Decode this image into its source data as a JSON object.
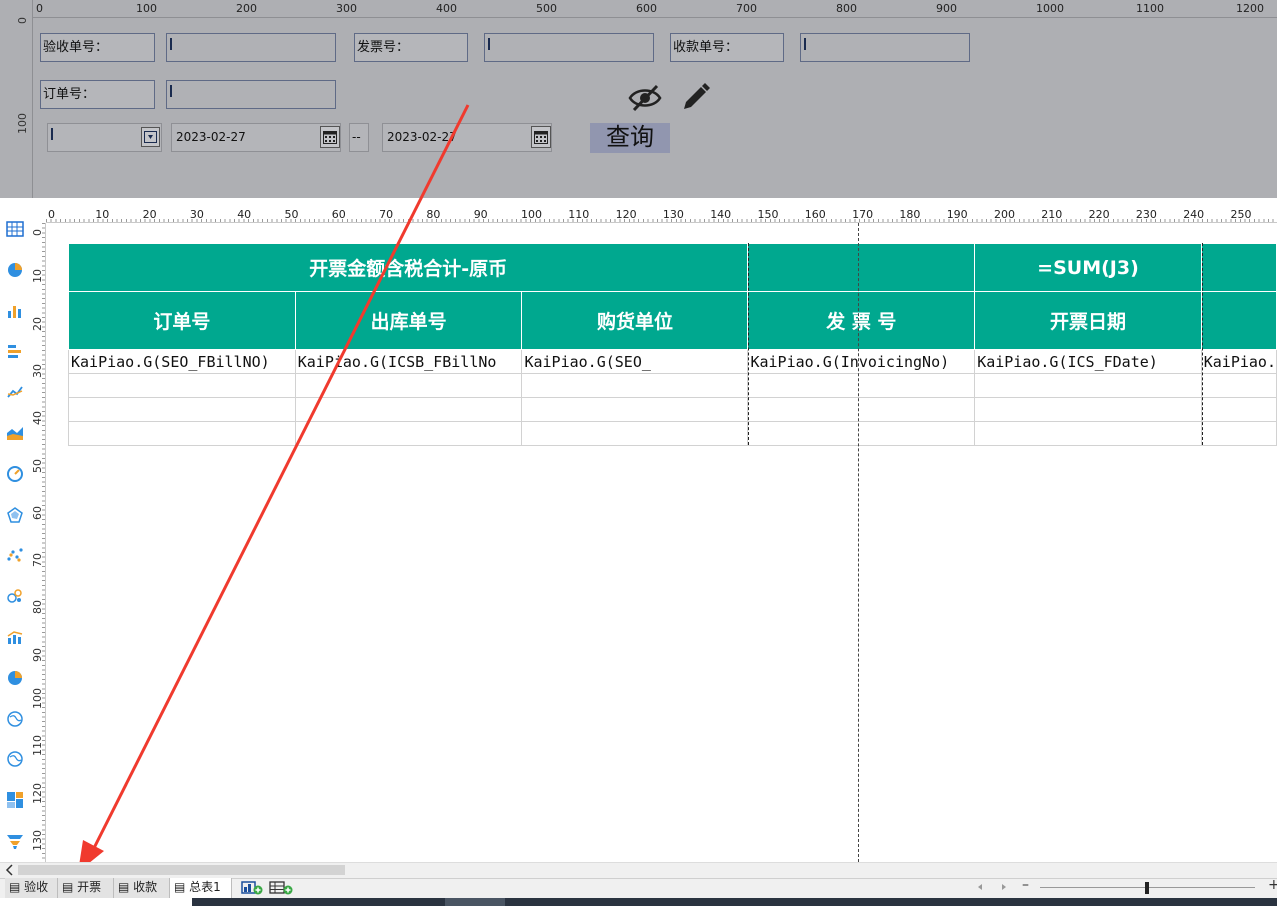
{
  "param_panel": {
    "ruler_top": [
      "0",
      "100",
      "200",
      "300",
      "400",
      "500",
      "600",
      "700",
      "800",
      "900",
      "1000",
      "1100",
      "1200"
    ],
    "ruler_left": [
      "0",
      "100"
    ],
    "fields": {
      "acceptance_no_label": "验收单号：",
      "invoice_no_label": "发票号：",
      "receipt_no_label": "收款单号：",
      "order_no_label": "订单号："
    },
    "start_date": "2023-02-27",
    "date_separator": "--",
    "end_date": "2023-02-27",
    "query_label": "查询"
  },
  "report": {
    "ruler_top": [
      "0",
      "10",
      "20",
      "30",
      "40",
      "50",
      "60",
      "70",
      "80",
      "90",
      "100",
      "110",
      "120",
      "130",
      "140",
      "150",
      "160",
      "170",
      "180",
      "190",
      "200",
      "210",
      "220",
      "230",
      "240",
      "250"
    ],
    "ruler_left": [
      "0",
      "10",
      "20",
      "30",
      "40",
      "50",
      "60",
      "70",
      "80",
      "90",
      "100",
      "110",
      "120",
      "130"
    ],
    "title_row": {
      "merged_title": "开票金额含税合计-原币",
      "formula": "=SUM(J3)"
    },
    "columns": [
      "订单号",
      "出库单号",
      "购货单位",
      "发 票 号",
      "开票日期",
      ""
    ],
    "data_row": [
      "KaiPiao.G(SEO_FBillNO)",
      "KaiPiao.G(ICSB_FBillNo",
      "KaiPiao.G(SEO_",
      "KaiPiao.G(InvoicingNo)",
      "KaiPiao.G(ICS_FDate)",
      "KaiPiao."
    ],
    "colors": {
      "header_bg": "#00a88f",
      "header_text": "#ffffff"
    }
  },
  "side_tools": [
    "table-icon",
    "pie-chart-icon",
    "bar-chart-icon",
    "horizontal-bar-icon",
    "line-chart-icon",
    "area-chart-icon",
    "gauge-icon",
    "radar-icon",
    "scatter-icon",
    "bubble-icon",
    "combo-chart-icon",
    "donut-icon",
    "map-icon",
    "map2-icon",
    "treemap-icon",
    "funnel-icon"
  ],
  "sheet_tabs": [
    {
      "label": "验收"
    },
    {
      "label": "开票"
    },
    {
      "label": "收款"
    },
    {
      "label": "总表1"
    }
  ],
  "zoom": {
    "minus": "–",
    "plus": "+"
  }
}
